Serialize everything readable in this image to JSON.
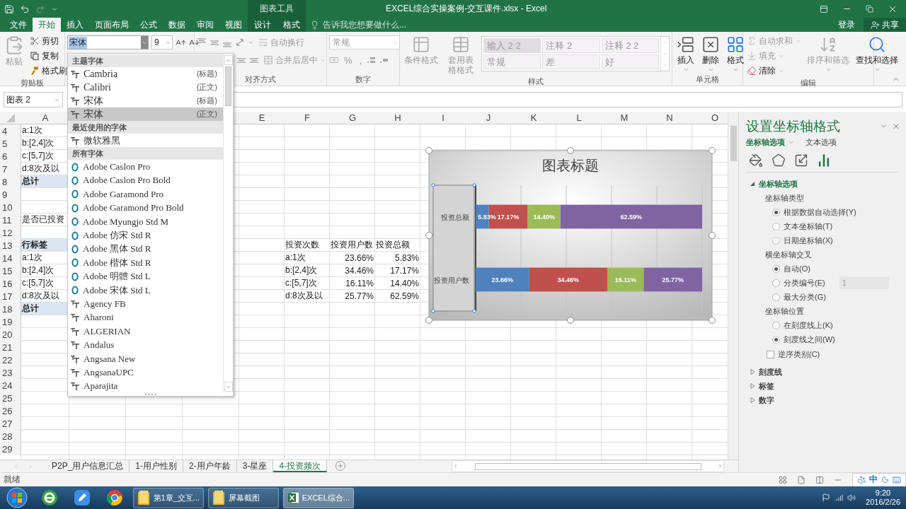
{
  "window": {
    "title": "EXCEL综合实操案例-交互课件.xlsx - Excel",
    "context_group": "图表工具"
  },
  "account": {
    "sign_in": "登录",
    "share": "共享"
  },
  "tabs": [
    {
      "label": "文件",
      "selected": false,
      "contextual": false
    },
    {
      "label": "开始",
      "selected": true,
      "contextual": false
    },
    {
      "label": "插入",
      "selected": false,
      "contextual": false
    },
    {
      "label": "页面布局",
      "selected": false,
      "contextual": false
    },
    {
      "label": "公式",
      "selected": false,
      "contextual": false
    },
    {
      "label": "数据",
      "selected": false,
      "contextual": false
    },
    {
      "label": "审阅",
      "selected": false,
      "contextual": false
    },
    {
      "label": "视图",
      "selected": false,
      "contextual": false
    },
    {
      "label": "设计",
      "selected": false,
      "contextual": true
    },
    {
      "label": "格式",
      "selected": false,
      "contextual": true
    }
  ],
  "tell_me": {
    "placeholder": "告诉我您想要做什么..."
  },
  "ribbon": {
    "clipboard": {
      "label": "剪贴板",
      "paste": {
        "label": "粘贴",
        "disabled": true
      },
      "small": [
        {
          "kind": "cut",
          "label": "剪切",
          "disabled": false
        },
        {
          "kind": "copy",
          "label": "复制",
          "disabled": false
        },
        {
          "kind": "painter",
          "label": "格式刷",
          "disabled": false
        }
      ]
    },
    "font": {
      "name": "宋体",
      "highlighted": true,
      "size": "9"
    },
    "alignment": {
      "label": "对齐方式",
      "commands": [
        {
          "kind": "wrap",
          "label": "自动换行",
          "disabled": true
        },
        {
          "kind": "merge",
          "label": "合并后居中",
          "disabled": true
        }
      ]
    },
    "number": {
      "label": "数字",
      "format": "常规",
      "disabled": true,
      "symbols": [
        "%",
        ","
      ]
    },
    "styles": {
      "label": "样式",
      "commands": [
        {
          "kind": "conditional",
          "label": "条件格式",
          "disabled": true
        },
        {
          "kind": "table",
          "label": "套用表格格式",
          "disabled": true
        }
      ],
      "gallery": [
        {
          "label": "输入 2 2",
          "selected": true
        },
        {
          "label": "注释 2",
          "selected": false
        },
        {
          "label": "注释 2 2",
          "selected": false
        },
        {
          "label": "常规",
          "selected": false
        },
        {
          "label": "差",
          "selected": false
        },
        {
          "label": "好",
          "selected": false
        }
      ]
    },
    "cells": {
      "label": "单元格",
      "commands": [
        {
          "kind": "insert",
          "label": "插入",
          "disabled": false
        },
        {
          "kind": "delete",
          "label": "删除",
          "disabled": false
        },
        {
          "kind": "format",
          "label": "格式",
          "disabled": false
        }
      ]
    },
    "editing": {
      "label": "编辑",
      "small": [
        {
          "kind": "autosum",
          "label": "自动求和",
          "disabled": true
        },
        {
          "kind": "fill",
          "label": "填充",
          "disabled": true
        },
        {
          "kind": "clear",
          "label": "清除",
          "disabled": false
        }
      ],
      "large": [
        {
          "kind": "sort",
          "label": "排序和筛选",
          "disabled": true
        },
        {
          "kind": "find",
          "label": "查找和选择",
          "disabled": false
        }
      ]
    }
  },
  "name_box": "图表 2",
  "sheet": {
    "columns": [
      "A",
      "E",
      "F",
      "G",
      "H",
      "I",
      "J",
      "K",
      "L",
      "M",
      "N",
      "O"
    ],
    "rows": [
      {
        "header": "4",
        "a": {
          "text": "a:1次",
          "kind": "text"
        }
      },
      {
        "header": "5",
        "a": {
          "text": "b:[2,4]次",
          "kind": "text"
        }
      },
      {
        "header": "6",
        "a": {
          "text": "c:[5,7]次",
          "kind": "text"
        }
      },
      {
        "header": "7",
        "a": {
          "text": "d:8次及以",
          "kind": "text"
        }
      },
      {
        "header": "8",
        "a": {
          "text": "总计",
          "kind": "band"
        }
      },
      {
        "header": "9"
      },
      {
        "header": "10"
      },
      {
        "header": "11",
        "a": {
          "text": "是否已投资",
          "kind": "text"
        }
      },
      {
        "header": "12"
      },
      {
        "header": "13",
        "a": {
          "text": "行标签",
          "kind": "band"
        },
        "f": {
          "text": "投资次数",
          "kind": "text"
        },
        "g": {
          "text": "投资用户数",
          "kind": "text"
        },
        "h": {
          "text": "投资总额",
          "kind": "text"
        }
      },
      {
        "header": "14",
        "a": {
          "text": "a:1次",
          "kind": "text"
        },
        "f": {
          "text": "a:1次",
          "kind": "text"
        },
        "g": {
          "text": "23.66%",
          "kind": "number"
        },
        "h": {
          "text": "5.83%",
          "kind": "number"
        }
      },
      {
        "header": "15",
        "a": {
          "text": "b:[2,4]次",
          "kind": "text"
        },
        "f": {
          "text": "b:[2,4]次",
          "kind": "text"
        },
        "g": {
          "text": "34.46%",
          "kind": "number"
        },
        "h": {
          "text": "17.17%",
          "kind": "number"
        }
      },
      {
        "header": "16",
        "a": {
          "text": "c:[5,7]次",
          "kind": "text"
        },
        "f": {
          "text": "c:[5,7]次",
          "kind": "text"
        },
        "g": {
          "text": "16.11%",
          "kind": "number"
        },
        "h": {
          "text": "14.40%",
          "kind": "number"
        }
      },
      {
        "header": "17",
        "a": {
          "text": "d:8次及以",
          "kind": "text"
        },
        "f": {
          "text": "d:8次及以",
          "kind": "text"
        },
        "g": {
          "text": "25.77%",
          "kind": "number"
        },
        "h": {
          "text": "62.59%",
          "kind": "number"
        }
      },
      {
        "header": "18",
        "a": {
          "text": "总计",
          "kind": "band"
        }
      },
      {
        "header": "19"
      },
      {
        "header": "20"
      },
      {
        "header": "21"
      },
      {
        "header": "22"
      },
      {
        "header": "23"
      },
      {
        "header": "24"
      },
      {
        "header": "25"
      },
      {
        "header": "26"
      },
      {
        "header": "27"
      },
      {
        "header": "28"
      },
      {
        "header": "29"
      }
    ]
  },
  "chart": {
    "chart_data": {
      "type": "bar",
      "orientation": "horizontal",
      "stacked": true,
      "data_labels": true,
      "title": "图表标题",
      "categories": [
        "投资总额",
        "投资用户数"
      ],
      "series": [
        {
          "color": "#4f81bd",
          "values": [
            5.83,
            23.66
          ],
          "value_labels": [
            "5.83%",
            "23.66%"
          ]
        },
        {
          "color": "#c0504d",
          "values": [
            17.17,
            34.46
          ],
          "value_labels": [
            "17.17%",
            "34.46%"
          ]
        },
        {
          "color": "#9bbb59",
          "values": [
            14.4,
            16.11
          ],
          "value_labels": [
            "14.40%",
            "16.11%"
          ]
        },
        {
          "color": "#8064a2",
          "values": [
            62.59,
            25.77
          ],
          "value_labels": [
            "62.59%",
            "25.77%"
          ]
        }
      ]
    }
  },
  "font_menu": {
    "sections": [
      {
        "label": "主题字体",
        "fonts": [
          {
            "name": "Cambria",
            "kind": "truetype",
            "note": "(标题)",
            "selected": false
          },
          {
            "name": "Calibri",
            "kind": "truetype",
            "note": "(正文)",
            "selected": false
          },
          {
            "name": "宋体",
            "kind": "truetype",
            "note": "(标题)",
            "selected": false
          },
          {
            "name": "宋体",
            "kind": "truetype",
            "note": "(正文)",
            "selected": true
          }
        ]
      },
      {
        "label": "最近使用的字体",
        "fonts": [
          {
            "name": "微软雅黑",
            "kind": "truetype",
            "selected": false
          }
        ]
      },
      {
        "label": "所有字体",
        "fonts": [
          {
            "name": "Adobe Caslon Pro",
            "kind": "opentype",
            "selected": false
          },
          {
            "name": "Adobe Caslon Pro Bold",
            "kind": "opentype",
            "selected": false
          },
          {
            "name": "Adobe Garamond Pro",
            "kind": "opentype",
            "selected": false
          },
          {
            "name": "Adobe Garamond Pro Bold",
            "kind": "opentype",
            "selected": false
          },
          {
            "name": "Adobe Myungjo Std M",
            "kind": "opentype",
            "selected": false
          },
          {
            "name": "Adobe 仿宋 Std R",
            "kind": "opentype",
            "selected": false
          },
          {
            "name": "Adobe 黑体 Std R",
            "kind": "opentype",
            "selected": false
          },
          {
            "name": "Adobe 楷体 Std R",
            "kind": "opentype",
            "selected": false
          },
          {
            "name": "Adobe 明體 Std L",
            "kind": "opentype",
            "selected": false
          },
          {
            "name": "Adobe 宋体 Std L",
            "kind": "opentype",
            "selected": false
          },
          {
            "name": "Agency FB",
            "kind": "truetype",
            "selected": false
          },
          {
            "name": "Aharoni",
            "kind": "truetype",
            "selected": false
          },
          {
            "name": "ALGERIAN",
            "kind": "truetype",
            "selected": false
          },
          {
            "name": "Andalus",
            "kind": "truetype",
            "selected": false
          },
          {
            "name": "Angsana New",
            "kind": "truetype",
            "selected": false
          },
          {
            "name": "AngsanaUPC",
            "kind": "truetype",
            "selected": false
          },
          {
            "name": "Aparajita",
            "kind": "truetype",
            "selected": false
          }
        ]
      }
    ]
  },
  "format_pane": {
    "title": "设置坐标轴格式",
    "tabs": [
      {
        "label": "坐标轴选项",
        "selected": true
      },
      {
        "label": "文本选项",
        "selected": false
      }
    ],
    "icons": [
      {
        "kind": "fill",
        "selected": false
      },
      {
        "kind": "effects",
        "selected": false
      },
      {
        "kind": "size",
        "selected": false
      },
      {
        "kind": "axis",
        "selected": true
      }
    ],
    "sections": [
      {
        "label": "坐标轴选项",
        "expanded": true,
        "groups": [
          {
            "label": "坐标轴类型",
            "options": [
              {
                "label": "根据数据自动选择(Y)",
                "selected": true
              },
              {
                "label": "文本坐标轴(T)",
                "selected": false
              },
              {
                "label": "日期坐标轴(X)",
                "selected": false
              }
            ]
          },
          {
            "label": "横坐标轴交叉",
            "options": [
              {
                "label": "自动(O)",
                "selected": true
              },
              {
                "label": "分类编号(E)",
                "selected": false,
                "value": "1"
              },
              {
                "label": "最大分类(G)",
                "selected": false
              }
            ]
          },
          {
            "label": "坐标轴位置",
            "options": [
              {
                "label": "在刻度线上(K)",
                "selected": false
              },
              {
                "label": "刻度线之间(W)",
                "selected": true
              }
            ]
          }
        ],
        "checkbox": {
          "label": "逆序类别(C)",
          "checked": false
        }
      },
      {
        "label": "刻度线",
        "expanded": false
      },
      {
        "label": "标签",
        "expanded": false
      },
      {
        "label": "数字",
        "expanded": false
      }
    ]
  },
  "sheet_tabs": [
    {
      "label": "P2P_用户信息汇总",
      "selected": false
    },
    {
      "label": "1-用户性别",
      "selected": false
    },
    {
      "label": "2-用户年龄",
      "selected": false
    },
    {
      "label": "3-星座",
      "selected": false
    },
    {
      "label": "4-投资频次",
      "selected": true
    }
  ],
  "status": "就绪",
  "ime": {
    "label": "中"
  },
  "taskbar": {
    "pinned": [
      {
        "kind": "ie"
      },
      {
        "kind": "pen"
      },
      {
        "kind": "chrome"
      }
    ],
    "windows": [
      {
        "label": "第1章_交互...",
        "kind": "folder",
        "selected": false
      },
      {
        "label": "屏幕截图",
        "kind": "folder",
        "selected": false
      },
      {
        "label": "EXCEL综合...",
        "kind": "excel",
        "selected": true
      }
    ],
    "time": "9:20",
    "date": "2016/2/26"
  }
}
